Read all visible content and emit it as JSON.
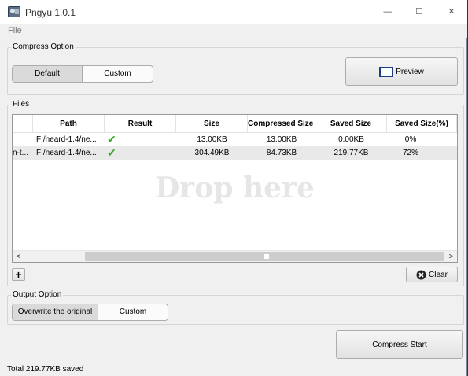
{
  "window": {
    "title": "Pngyu 1.0.1",
    "minimize": "—",
    "maximize": "☐",
    "close": "✕"
  },
  "menu": {
    "file": "File"
  },
  "compress_option": {
    "label": "Compress Option",
    "default_label": "Default",
    "custom_label": "Custom",
    "preview_label": "Preview"
  },
  "files": {
    "label": "Files",
    "columns": [
      "Path",
      "Result",
      "Size",
      "Compressed Size",
      "Saved Size",
      "Saved Size(%)"
    ],
    "rows": [
      {
        "name": "",
        "path": "F:/neard-1.4/ne...",
        "result": "✔",
        "size": "13.00KB",
        "compressed": "13.00KB",
        "saved": "0.00KB",
        "saved_pct": "0%"
      },
      {
        "name": "n-t...",
        "path": "F:/neard-1.4/ne...",
        "result": "✔",
        "size": "304.49KB",
        "compressed": "84.73KB",
        "saved": "219.77KB",
        "saved_pct": "72%"
      }
    ],
    "drop_text": "Drop here",
    "add_label": "+",
    "clear_label": "Clear"
  },
  "output_option": {
    "label": "Output Option",
    "overwrite_label": "Overwrite the original",
    "custom_label": "Custom"
  },
  "compress_start": "Compress Start",
  "status": "Total 219.77KB saved",
  "colors": {
    "check": "#3aa82a",
    "selected_segment": "#dadada",
    "drop_text": "#e6e6e6"
  },
  "icons": [
    "app-icon",
    "preview-icon",
    "check-icon",
    "add-icon",
    "clear-icon",
    "scroll-left-icon",
    "scroll-right-icon"
  ]
}
